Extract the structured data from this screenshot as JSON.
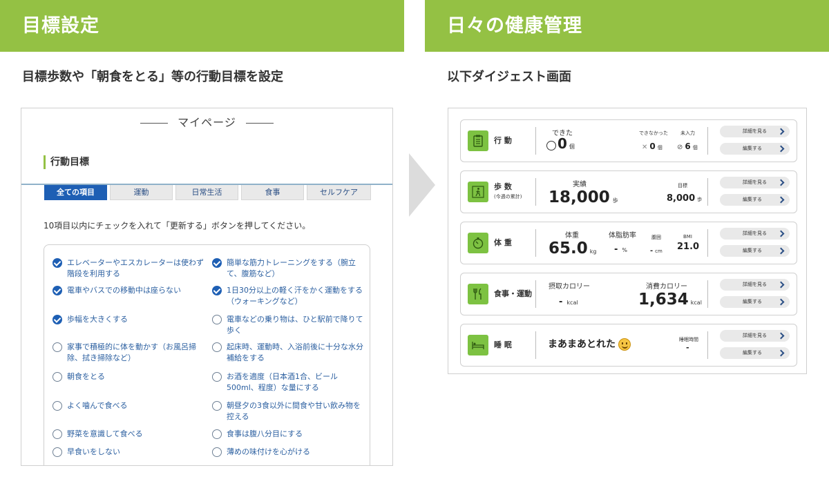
{
  "left": {
    "banner": "目標設定",
    "subtitle": "目標歩数や「朝食をとる」等の行動目標を設定",
    "mypage_title": "マイページ",
    "section_title": "行動目標",
    "tabs": [
      {
        "label": "全ての項目",
        "active": true
      },
      {
        "label": "運動",
        "active": false
      },
      {
        "label": "日常生活",
        "active": false
      },
      {
        "label": "食事",
        "active": false
      },
      {
        "label": "セルフケア",
        "active": false
      }
    ],
    "instruction": "10項目以内にチェックを入れて「更新する」ボタンを押してください。",
    "items": [
      {
        "label": "エレベーターやエスカレーターは使わず階段を利用する",
        "checked": true
      },
      {
        "label": "簡単な筋力トレーニングをする（腕立て、腹筋など）",
        "checked": true
      },
      {
        "label": "電車やバスでの移動中は座らない",
        "checked": true
      },
      {
        "label": "1日30分以上の軽く汗をかく運動をする（ウォーキングなど）",
        "checked": true
      },
      {
        "label": "歩幅を大きくする",
        "checked": true
      },
      {
        "label": "電車などの乗り物は、ひと駅前で降りて歩く",
        "checked": false
      },
      {
        "label": "家事で積極的に体を動かす（お風呂掃除、拭き掃除など）",
        "checked": false
      },
      {
        "label": "起床時、運動時、入浴前後に十分な水分補給をする",
        "checked": false
      },
      {
        "label": "朝食をとる",
        "checked": false
      },
      {
        "label": "お酒を適度（日本酒1合、ビール500ml、程度）な量にする",
        "checked": false
      },
      {
        "label": "よく噛んで食べる",
        "checked": false
      },
      {
        "label": "朝昼夕の3食以外に間食や甘い飲み物を控える",
        "checked": false
      },
      {
        "label": "野菜を意識して食べる",
        "checked": false
      },
      {
        "label": "食事は腹八分目にする",
        "checked": false
      },
      {
        "label": "早食いをしない",
        "checked": false
      },
      {
        "label": "薄めの味付けを心がける",
        "checked": false
      }
    ]
  },
  "right": {
    "banner": "日々の健康管理",
    "subtitle": "以下ダイジェスト画面",
    "buttons": {
      "detail": "詳細を見る",
      "edit": "編集する"
    },
    "cards": {
      "action": {
        "label": "行 動",
        "done_label": "できた",
        "done_value": "0",
        "done_unit": "個",
        "notdone_label": "できなかった",
        "notdone_value": "0",
        "notdone_unit": "個",
        "unentered_label": "未入力",
        "unentered_value": "6",
        "unentered_unit": "個"
      },
      "steps": {
        "label": "歩 数",
        "sublabel": "(今週の累計)",
        "actual_label": "実績",
        "actual_value": "18,000",
        "actual_unit": "歩",
        "goal_label": "目標",
        "goal_value": "8,000",
        "goal_unit": "歩"
      },
      "weight": {
        "label": "体 重",
        "weight_label": "体重",
        "weight_value": "65.0",
        "weight_unit": "kg",
        "fat_label": "体脂肪率",
        "fat_value": "-",
        "fat_unit": "%",
        "waist_label": "腹囲",
        "waist_value": "-",
        "waist_unit": "cm",
        "bmi_label": "BMI",
        "bmi_value": "21.0"
      },
      "meal": {
        "label": "食事・運動",
        "intake_label": "摂取カロリー",
        "intake_value": "-",
        "intake_unit": "kcal",
        "burn_label": "消費カロリー",
        "burn_value": "1,634",
        "burn_unit": "kcal"
      },
      "sleep": {
        "label": "睡 眠",
        "status": "まあまあとれた",
        "time_label": "睡眠時間",
        "time_value": "-"
      }
    }
  }
}
